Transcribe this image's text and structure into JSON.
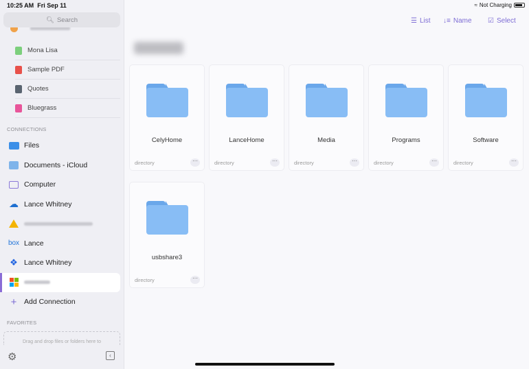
{
  "status_bar": {
    "time": "10:25 AM",
    "date": "Fri Sep 11",
    "battery_label": "Not Charging",
    "battery_level_percent": 85
  },
  "sidebar": {
    "search_placeholder": "Search",
    "recent_items": [
      {
        "label": "Mona Lisa",
        "icon": "image-icon",
        "color": "#7ccf7c"
      },
      {
        "label": "Sample PDF",
        "icon": "pdf-icon",
        "color": "#e8514a"
      },
      {
        "label": "Quotes",
        "icon": "text-file-icon",
        "color": "#5a6470"
      },
      {
        "label": "Bluegrass",
        "icon": "audio-file-icon",
        "color": "#e8559a"
      }
    ],
    "connections_label": "CONNECTIONS",
    "connections": [
      {
        "label": "Files",
        "icon": "files-icon"
      },
      {
        "label": "Documents - iCloud",
        "icon": "documents-icon"
      },
      {
        "label": "Computer",
        "icon": "computer-icon"
      },
      {
        "label": "Lance Whitney",
        "icon": "onedrive-icon"
      },
      {
        "label": "",
        "icon": "google-drive-icon"
      },
      {
        "label": "Lance",
        "icon": "box-icon",
        "icon_text": "box"
      },
      {
        "label": "Lance Whitney",
        "icon": "dropbox-icon"
      },
      {
        "label": "",
        "icon": "microsoft-icon",
        "active": true
      }
    ],
    "add_connection": "Add Connection",
    "favorites_label": "FAVORITES",
    "favorites_drop_hint": "Drag and drop files or folders here to"
  },
  "toolbar": {
    "list": "List",
    "sort": "Name",
    "select": "Select"
  },
  "folders": [
    {
      "name": "CelyHome",
      "type": "directory"
    },
    {
      "name": "LanceHome",
      "type": "directory"
    },
    {
      "name": "Media",
      "type": "directory"
    },
    {
      "name": "Programs",
      "type": "directory"
    },
    {
      "name": "Software",
      "type": "directory"
    },
    {
      "name": "usbshare3",
      "type": "directory"
    }
  ],
  "colors": {
    "accent": "#7c6bd4",
    "folder": "#88bdf5"
  }
}
